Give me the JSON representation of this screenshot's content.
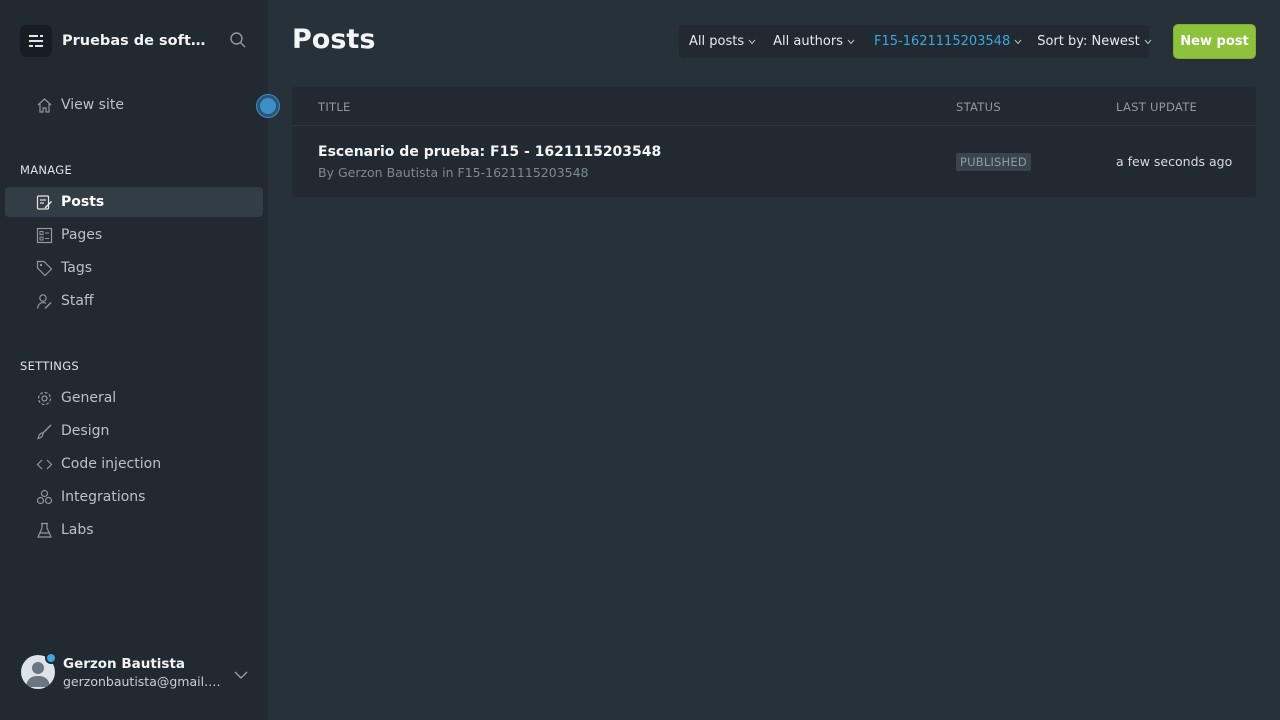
{
  "brand": {
    "name": "Pruebas de softwa...",
    "logo_icon": "ghost-logo-icon"
  },
  "nav": {
    "view_site": "View site",
    "manage_title": "MANAGE",
    "manage_items": [
      {
        "label": "Posts",
        "icon": "posts-icon"
      },
      {
        "label": "Pages",
        "icon": "pages-icon"
      },
      {
        "label": "Tags",
        "icon": "tags-icon"
      },
      {
        "label": "Staff",
        "icon": "staff-icon"
      }
    ],
    "settings_title": "SETTINGS",
    "settings_items": [
      {
        "label": "General",
        "icon": "gear-icon"
      },
      {
        "label": "Design",
        "icon": "brush-icon"
      },
      {
        "label": "Code injection",
        "icon": "code-icon"
      },
      {
        "label": "Integrations",
        "icon": "integrations-icon"
      },
      {
        "label": "Labs",
        "icon": "flask-icon"
      }
    ]
  },
  "user": {
    "name": "Gerzon Bautista",
    "email": "gerzonbautista@gmail.com"
  },
  "page": {
    "title": "Posts"
  },
  "filters": {
    "type": "All posts",
    "author": "All authors",
    "tag": "F15-1621115203548",
    "sort": "Sort by: Newest"
  },
  "new_post_label": "New post",
  "table": {
    "headers": {
      "title": "TITLE",
      "status": "STATUS",
      "last_update": "LAST UPDATE"
    },
    "rows": [
      {
        "title": "Escenario de prueba: F15 - 1621115203548",
        "meta": "By Gerzon Bautista in F15-1621115203548",
        "status": "PUBLISHED",
        "updated": "a few seconds ago"
      }
    ]
  },
  "colors": {
    "accent": "#3ea6e0",
    "primary_button": "#8fc23c",
    "sidebar_bg": "#212a31",
    "main_bg": "#27313a"
  }
}
